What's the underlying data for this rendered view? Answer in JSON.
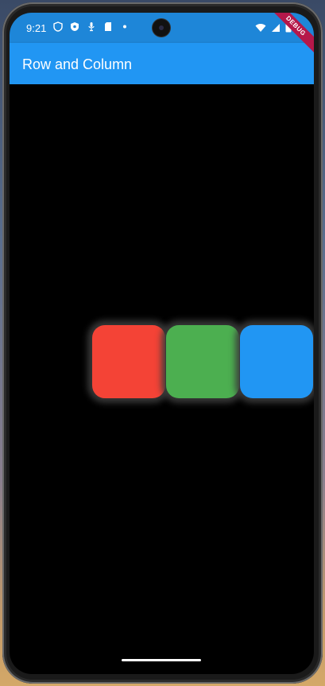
{
  "status_bar": {
    "time": "9:21",
    "left_icons": [
      "shield-outline-icon",
      "shield-filled-icon",
      "microphone-icon",
      "sd-card-icon",
      "dot-icon"
    ],
    "right_icons": [
      "wifi-icon",
      "signal-icon",
      "battery-icon"
    ],
    "background_color": "#1e86d8"
  },
  "app_bar": {
    "title": "Row and Column",
    "background_color": "#2196f3"
  },
  "debug_banner": {
    "label": "DEBUG"
  },
  "row": {
    "boxes": [
      {
        "name": "red-box",
        "color": "#f44336"
      },
      {
        "name": "green-box",
        "color": "#4caf50"
      },
      {
        "name": "blue-box",
        "color": "#2196f3"
      }
    ]
  },
  "screen": {
    "background_color": "#000000"
  }
}
